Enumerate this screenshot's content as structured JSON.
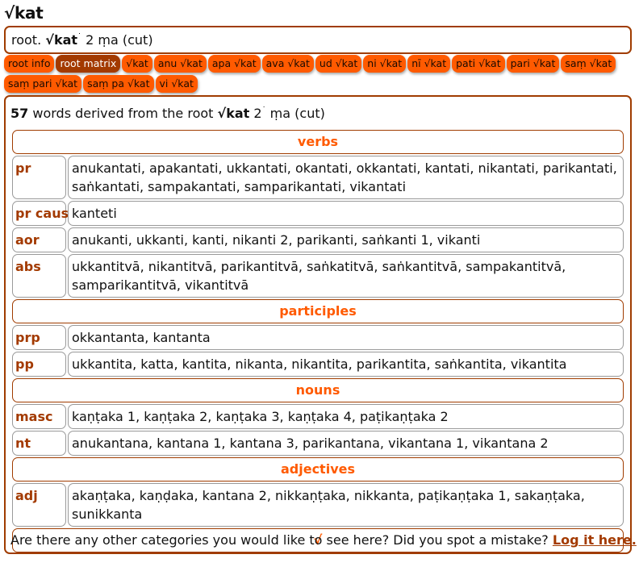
{
  "title": "√kat",
  "summary": {
    "prefix": "root.",
    "root": "√kat",
    "superscript": "˙",
    "rest": "2 ṃa (cut)"
  },
  "tabs": {
    "row1": [
      "root info",
      "root matrix",
      "√kat",
      "anu √kat",
      "apa √kat",
      "ava √kat",
      "ud √kat",
      "ni √kat",
      "nī √kat",
      "pati √kat",
      "pari √kat",
      "saṃ √kat"
    ],
    "row2": [
      "saṃ pari √kat",
      "saṃ pa √kat",
      "vi √kat"
    ],
    "active": "root matrix"
  },
  "panel": {
    "count": "57",
    "count_text": "words derived from the root",
    "root": "√kat",
    "root_num": "2",
    "root_sup": "˙",
    "root_rest": "ṃa (cut)",
    "sections": [
      {
        "heading": "verbs",
        "rows": [
          {
            "label": "pr",
            "value": "anukantati, apakantati, ukkantati, okantati, okkantati, kantati, nikantati, parikantati, saṅkantati, sampakantati, samparikantati, vikantati"
          },
          {
            "label": "pr caus",
            "value": "kanteti"
          },
          {
            "label": "aor",
            "value": "anukanti, ukkanti, kanti, nikanti 2, parikanti, saṅkanti 1, vikanti"
          },
          {
            "label": "abs",
            "value": "ukkantitvā, nikantitvā, parikantitvā, saṅkatitvā, saṅkantitvā, sampakantitvā, samparikantitvā, vikantitvā"
          }
        ]
      },
      {
        "heading": "participles",
        "rows": [
          {
            "label": "prp",
            "value": "okkantanta, kantanta"
          },
          {
            "label": "pp",
            "value": "ukkantita, katta, kantita, nikanta, nikantita, parikantita, saṅkantita, vikantita"
          }
        ]
      },
      {
        "heading": "nouns",
        "rows": [
          {
            "label": "masc",
            "value": "kaṇṭaka 1, kaṇṭaka 2, kaṇṭaka 3, kaṇṭaka 4, paṭikaṇṭaka 2"
          },
          {
            "label": "nt",
            "value": "anukantana, kantana 1, kantana 3, parikantana, vikantana 1, vikantana 2"
          }
        ]
      },
      {
        "heading": "adjectives",
        "rows": [
          {
            "label": "adj",
            "value": "akaṇṭaka, kaṇḍaka, kantana 2, nikkaṇṭaka, nikkanta, paṭikaṇṭaka 1, sakaṇṭaka, sunikkanta"
          }
        ]
      },
      {
        "heading": "√",
        "rows": []
      }
    ],
    "footer_text": "Are there any other categories you would like to see here? Did you spot a mistake?",
    "footer_link": "Log it here."
  },
  "colors": {
    "accent_dark": "#a33a00",
    "accent_bright": "#ff5a00",
    "border": "#a03c00"
  }
}
